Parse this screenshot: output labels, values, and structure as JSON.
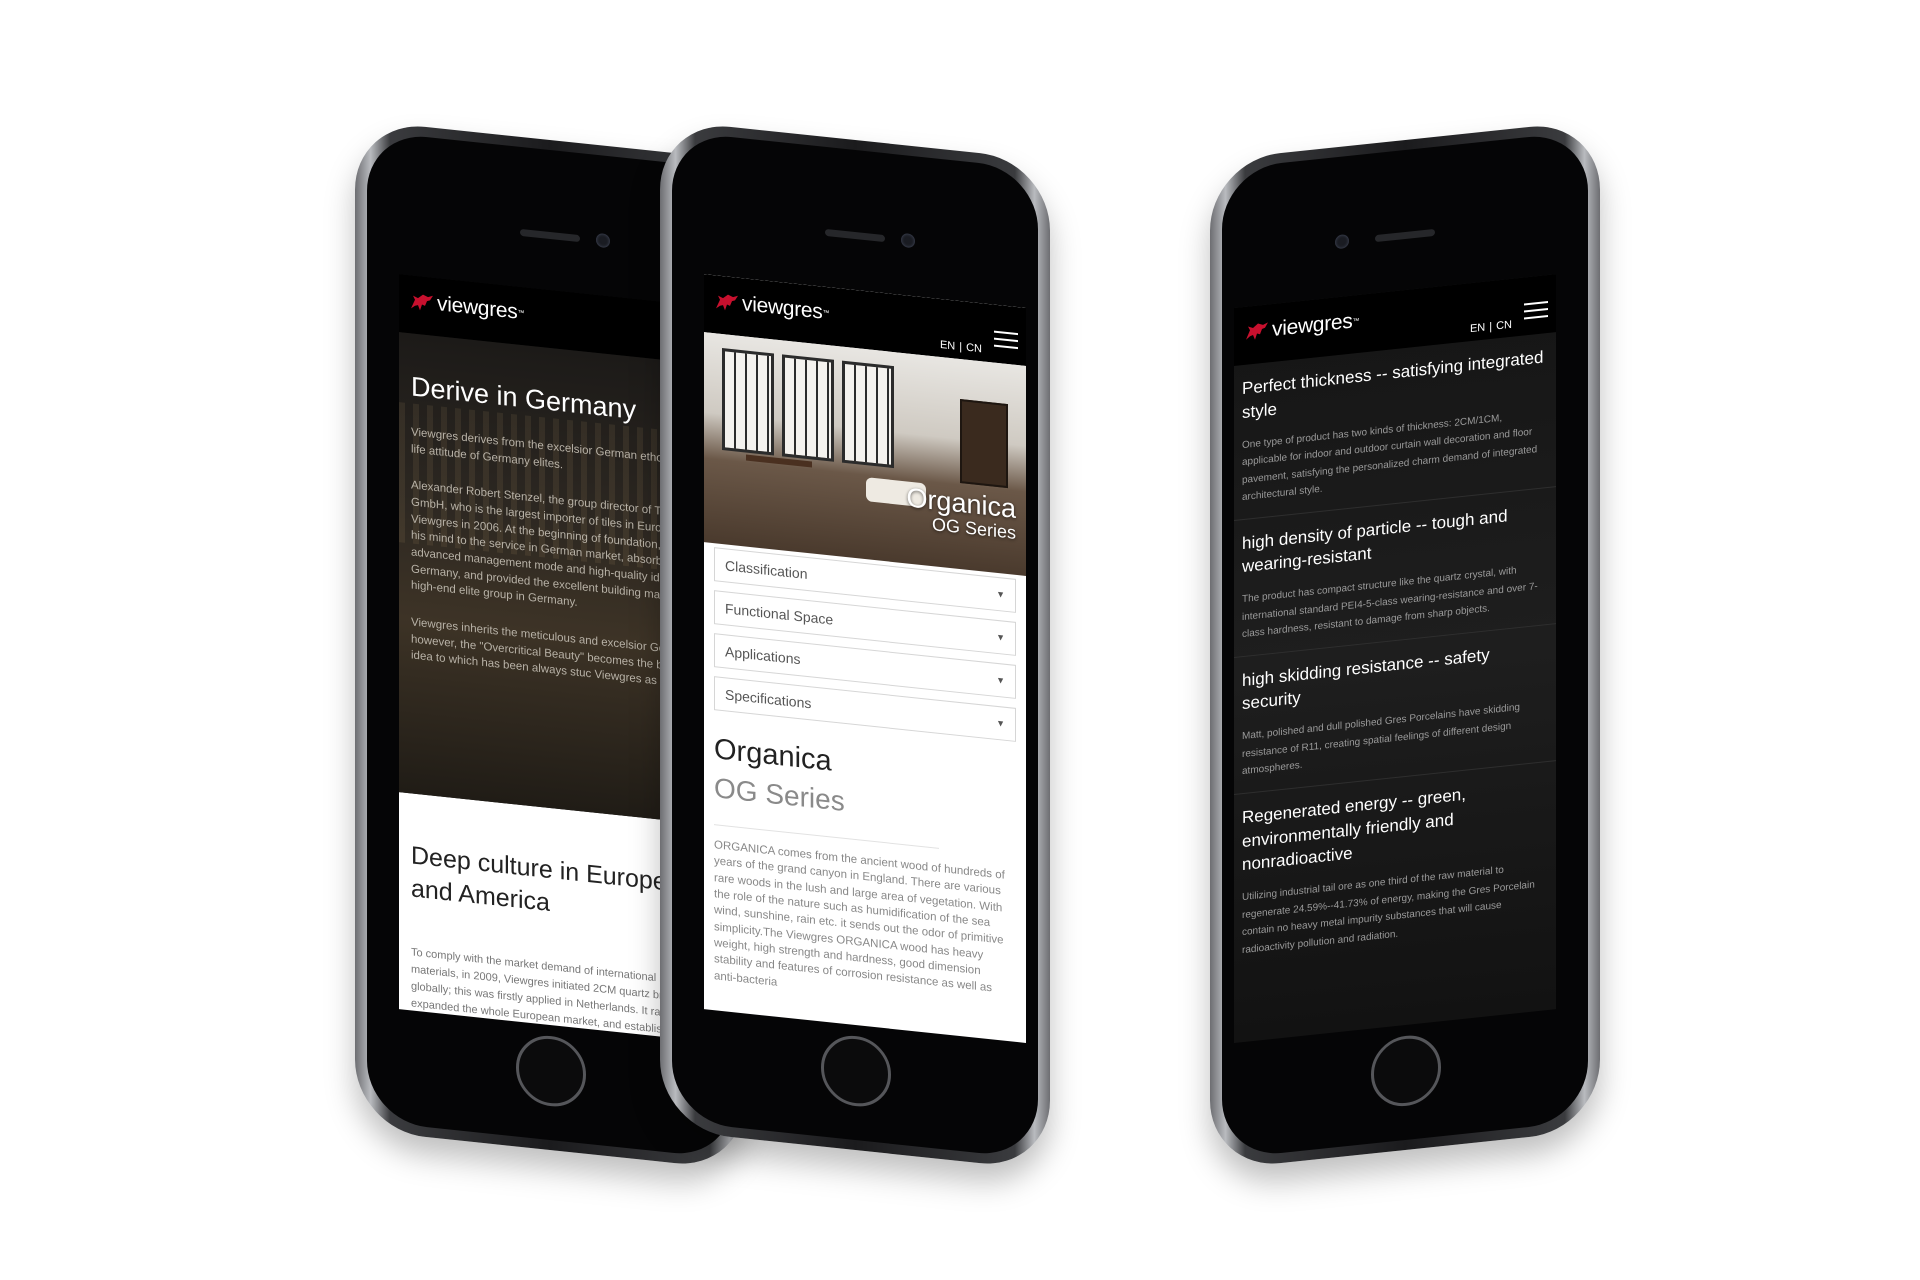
{
  "brand": {
    "logo_text": "viewgres",
    "tm": "™",
    "lang_en": "EN",
    "lang_sep": "|",
    "lang_cn": "CN",
    "accent": "#c8102e"
  },
  "left": {
    "hero_title": "Derive in Germany",
    "hero_p1": "Viewgres derives from the excelsior German ethos, inte a life attitude of Germany elites.",
    "hero_p2": "Alexander Robert Stenzel, the group director of T Tradi GmbH, who is the largest importer of tiles in Europ inve Viewgres in 2006. At the beginning of foundation, he de his mind to the service in German market, absorbed the advanced management mode and high-quality idea in Germany, and provided the excellent building materials high-end elite group in Germany.",
    "hero_p3": "Viewgres inherits the meticulous and excelsior German however, the \"Overcritical Beauty\" becomes the brand idea to which has been always stuc Viewgres as well.",
    "section_title": "Deep culture in Europe and America",
    "section_p": "To comply with the market demand of international buil materials, in 2009, Viewgres initiated 2CM quartz brick globally; this was firstly applied in Netherlands. It rapidl expanded the whole European market, and established branch soon afterwards in the American market, simultaneously, it divergently developed in the Europea"
  },
  "middle": {
    "hero_title": "Organica",
    "hero_subtitle": "OG Series",
    "filters": [
      "Classification",
      "Functional Space",
      "Applications",
      "Specifications"
    ],
    "product_title": "Organica",
    "product_series": "OG Series",
    "description": "ORGANICA comes from the ancient wood of hundreds of years of the grand canyon in England. There are various rare woods in the lush and large area of vegetation. With the role of the nature such as humidification of the sea wind, sunshine, rain etc. it sends out the odor of primitive simplicity.The Viewgres ORGANICA wood has heavy weight, high strength and hardness, good dimension stability and features of corrosion resistance as well as anti-bacteria"
  },
  "right": {
    "features": [
      {
        "title": "Perfect thickness -- satisfying integrated style",
        "text": "One type of product has two kinds of thickness: 2CM/1CM, applicable for indoor and outdoor curtain wall decoration and floor pavement, satisfying the personalized charm demand of integrated architectural style."
      },
      {
        "title": "high density of particle -- tough and wearing-resistant",
        "text": "The product has compact structure like the quartz crystal, with international standard PEI4-5-class wearing-resistance and over 7-class hardness, resistant to damage from sharp objects."
      },
      {
        "title": "high skidding resistance -- safety security",
        "text": "Matt, polished and dull polished Gres Porcelains have skidding resistance of R11, creating spatial feelings of different design atmospheres."
      },
      {
        "title": "Regenerated energy -- green, environmentally friendly and nonradioactive",
        "text": "Utilizing industrial tail ore as one third of the raw material to regenerate 24.59%--41.73% of energy, making the Gres Porcelain contain no heavy metal impurity substances that will cause radioactivity pollution and radiation."
      }
    ]
  }
}
